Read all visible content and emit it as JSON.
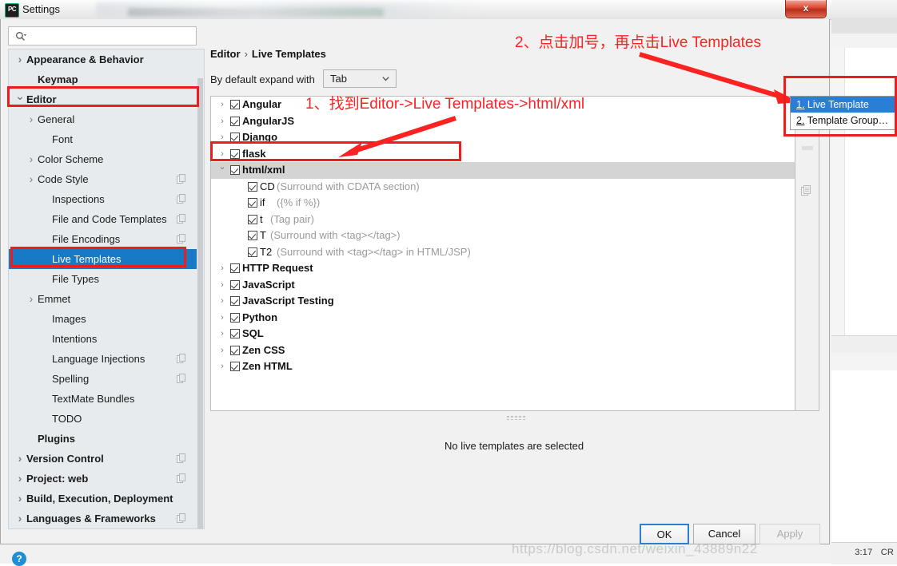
{
  "window": {
    "title": "Settings",
    "app_icon": "pycharm-icon",
    "close_label": "x"
  },
  "search": {
    "value": "",
    "placeholder": "",
    "icon": "search-icon"
  },
  "sidebar": {
    "items": [
      {
        "label": "Appearance & Behavior",
        "indent": 1,
        "arrow": "right",
        "bold": true,
        "copy": false,
        "selected": false
      },
      {
        "label": "Keymap",
        "indent": 2,
        "arrow": "",
        "bold": true,
        "copy": false,
        "selected": false
      },
      {
        "label": "Editor",
        "indent": 1,
        "arrow": "down",
        "bold": true,
        "copy": false,
        "selected": false
      },
      {
        "label": "General",
        "indent": 2,
        "arrow": "right",
        "bold": false,
        "copy": false,
        "selected": false
      },
      {
        "label": "Font",
        "indent": 3,
        "arrow": "",
        "bold": false,
        "copy": false,
        "selected": false
      },
      {
        "label": "Color Scheme",
        "indent": 2,
        "arrow": "right",
        "bold": false,
        "copy": false,
        "selected": false
      },
      {
        "label": "Code Style",
        "indent": 2,
        "arrow": "right",
        "bold": false,
        "copy": true,
        "selected": false
      },
      {
        "label": "Inspections",
        "indent": 3,
        "arrow": "",
        "bold": false,
        "copy": true,
        "selected": false
      },
      {
        "label": "File and Code Templates",
        "indent": 3,
        "arrow": "",
        "bold": false,
        "copy": true,
        "selected": false
      },
      {
        "label": "File Encodings",
        "indent": 3,
        "arrow": "",
        "bold": false,
        "copy": true,
        "selected": false
      },
      {
        "label": "Live Templates",
        "indent": 3,
        "arrow": "",
        "bold": false,
        "copy": false,
        "selected": true
      },
      {
        "label": "File Types",
        "indent": 3,
        "arrow": "",
        "bold": false,
        "copy": false,
        "selected": false
      },
      {
        "label": "Emmet",
        "indent": 2,
        "arrow": "right",
        "bold": false,
        "copy": false,
        "selected": false
      },
      {
        "label": "Images",
        "indent": 3,
        "arrow": "",
        "bold": false,
        "copy": false,
        "selected": false
      },
      {
        "label": "Intentions",
        "indent": 3,
        "arrow": "",
        "bold": false,
        "copy": false,
        "selected": false
      },
      {
        "label": "Language Injections",
        "indent": 3,
        "arrow": "",
        "bold": false,
        "copy": true,
        "selected": false
      },
      {
        "label": "Spelling",
        "indent": 3,
        "arrow": "",
        "bold": false,
        "copy": true,
        "selected": false
      },
      {
        "label": "TextMate Bundles",
        "indent": 3,
        "arrow": "",
        "bold": false,
        "copy": false,
        "selected": false
      },
      {
        "label": "TODO",
        "indent": 3,
        "arrow": "",
        "bold": false,
        "copy": false,
        "selected": false
      },
      {
        "label": "Plugins",
        "indent": 2,
        "arrow": "",
        "bold": true,
        "copy": false,
        "selected": false
      },
      {
        "label": "Version Control",
        "indent": 1,
        "arrow": "right",
        "bold": true,
        "copy": true,
        "selected": false
      },
      {
        "label": "Project: web",
        "indent": 1,
        "arrow": "right",
        "bold": true,
        "copy": true,
        "selected": false
      },
      {
        "label": "Build, Execution, Deployment",
        "indent": 1,
        "arrow": "right",
        "bold": true,
        "copy": false,
        "selected": false
      },
      {
        "label": "Languages & Frameworks",
        "indent": 1,
        "arrow": "right",
        "bold": true,
        "copy": true,
        "selected": false
      }
    ]
  },
  "right": {
    "breadcrumb_root": "Editor",
    "breadcrumb_sep": "›",
    "breadcrumb_leaf": "Live Templates",
    "expand_label": "By default expand with",
    "expand_value": "Tab",
    "detail_message": "No live templates are selected"
  },
  "templates": [
    {
      "label": "Angular",
      "desc": "",
      "indent": 0,
      "arrow": "right",
      "bold": true,
      "checked": true,
      "selected": false
    },
    {
      "label": "AngularJS",
      "desc": "",
      "indent": 0,
      "arrow": "right",
      "bold": true,
      "checked": true,
      "selected": false
    },
    {
      "label": "Django",
      "desc": "",
      "indent": 0,
      "arrow": "right",
      "bold": true,
      "checked": true,
      "selected": false
    },
    {
      "label": "flask",
      "desc": "",
      "indent": 0,
      "arrow": "right",
      "bold": true,
      "checked": true,
      "selected": false
    },
    {
      "label": "html/xml",
      "desc": "",
      "indent": 0,
      "arrow": "down",
      "bold": true,
      "checked": true,
      "selected": true
    },
    {
      "label": "CD",
      "desc": "(Surround with CDATA section)",
      "indent": 1,
      "arrow": "",
      "bold": false,
      "checked": true,
      "selected": false
    },
    {
      "label": "if",
      "desc": "({% if %})",
      "indent": 1,
      "arrow": "",
      "bold": false,
      "checked": true,
      "selected": false
    },
    {
      "label": "t",
      "desc": "(Tag pair)",
      "indent": 1,
      "arrow": "",
      "bold": false,
      "checked": true,
      "selected": false
    },
    {
      "label": "T",
      "desc": "(Surround with <tag></tag>)",
      "indent": 1,
      "arrow": "",
      "bold": false,
      "checked": true,
      "selected": false
    },
    {
      "label": "T2",
      "desc": "(Surround with <tag></tag> in HTML/JSP)",
      "indent": 1,
      "arrow": "",
      "bold": false,
      "checked": true,
      "selected": false
    },
    {
      "label": "HTTP Request",
      "desc": "",
      "indent": 0,
      "arrow": "right",
      "bold": true,
      "checked": true,
      "selected": false
    },
    {
      "label": "JavaScript",
      "desc": "",
      "indent": 0,
      "arrow": "right",
      "bold": true,
      "checked": true,
      "selected": false
    },
    {
      "label": "JavaScript Testing",
      "desc": "",
      "indent": 0,
      "arrow": "right",
      "bold": true,
      "checked": true,
      "selected": false
    },
    {
      "label": "Python",
      "desc": "",
      "indent": 0,
      "arrow": "right",
      "bold": true,
      "checked": true,
      "selected": false
    },
    {
      "label": "SQL",
      "desc": "",
      "indent": 0,
      "arrow": "right",
      "bold": true,
      "checked": true,
      "selected": false
    },
    {
      "label": "Zen CSS",
      "desc": "",
      "indent": 0,
      "arrow": "right",
      "bold": true,
      "checked": true,
      "selected": false
    },
    {
      "label": "Zen HTML",
      "desc": "",
      "indent": 0,
      "arrow": "right",
      "bold": true,
      "checked": true,
      "selected": false
    }
  ],
  "toolbar": {
    "add_label": "+",
    "duplicate_icon": "duplicate-icon"
  },
  "popup": {
    "items": [
      {
        "num": "1.",
        "label": " Live Template",
        "active": true
      },
      {
        "num": "2.",
        "label": " Template Group…",
        "active": false
      }
    ]
  },
  "buttons": {
    "ok": "OK",
    "cancel": "Cancel",
    "apply": "Apply",
    "help": "?"
  },
  "annotations": {
    "note1": "1、找到Editor->Live Templates->html/xml",
    "note2": "2、点击加号，再点击Live Templates",
    "color": "#fc2222"
  },
  "ide": {
    "status_time": "3:17",
    "status_enc": "CR",
    "watermark": "https://blog.csdn.net/weixin_43889n22"
  }
}
